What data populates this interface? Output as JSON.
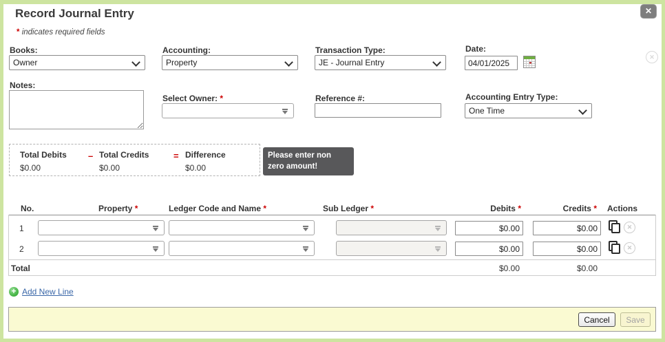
{
  "header": {
    "title": "Record Journal Entry",
    "required_mark": "*",
    "required_note": "indicates required fields"
  },
  "icons": {
    "close": "✕",
    "clear": "✕",
    "plus": "+"
  },
  "form": {
    "books": {
      "label": "Books:",
      "value": "Owner"
    },
    "accounting": {
      "label": "Accounting:",
      "value": "Property"
    },
    "transaction_type": {
      "label": "Transaction Type:",
      "value": "JE - Journal Entry"
    },
    "date": {
      "label": "Date:",
      "value": "04/01/2025"
    },
    "notes": {
      "label": "Notes:",
      "value": ""
    },
    "select_owner": {
      "label": "Select Owner:",
      "value": ""
    },
    "reference": {
      "label": "Reference #:",
      "value": ""
    },
    "accounting_entry_type": {
      "label": "Accounting Entry Type:",
      "value": "One Time"
    }
  },
  "totals": {
    "debits_label": "Total Debits",
    "debits_value": "$0.00",
    "minus": "–",
    "credits_label": "Total Credits",
    "credits_value": "$0.00",
    "equals": "=",
    "difference_label": "Difference",
    "difference_value": "$0.00"
  },
  "tooltip": {
    "text": "Please enter non zero amount!"
  },
  "table": {
    "headers": {
      "no": "No.",
      "property": "Property",
      "ledger": "Ledger Code and Name",
      "sub_ledger": "Sub Ledger",
      "debits": "Debits",
      "credits": "Credits",
      "actions": "Actions"
    },
    "rows": [
      {
        "no": "1",
        "property": "",
        "ledger": "",
        "sub_ledger": "",
        "debits": "$0.00",
        "credits": "$0.00"
      },
      {
        "no": "2",
        "property": "",
        "ledger": "",
        "sub_ledger": "",
        "debits": "$0.00",
        "credits": "$0.00"
      }
    ],
    "total_label": "Total",
    "total_debits": "$0.00",
    "total_credits": "$0.00"
  },
  "add_new_line": {
    "label": "Add New Line"
  },
  "footer": {
    "cancel_label": "Cancel",
    "save_label": "Save"
  },
  "colors": {
    "frame_green": "#cde4a0",
    "footer_bg": "#fafad2",
    "tooltip_bg": "#58585a",
    "required_red": "#cc0000",
    "link_blue": "#3a67a8",
    "add_green": "#1f9e1f",
    "close_gray": "#7e7e7e"
  }
}
